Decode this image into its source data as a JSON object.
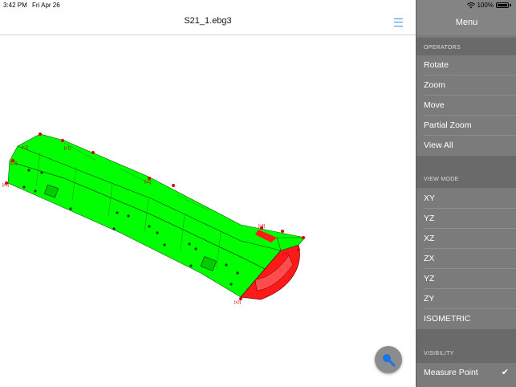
{
  "status_bar": {
    "time": "3:42 PM",
    "date": "Fri Apr 26",
    "battery": "100%"
  },
  "document": {
    "title": "S21_1.ebg3"
  },
  "sidebar": {
    "title": "Menu",
    "sections": [
      {
        "header": "OPERATORS",
        "items": [
          "Rotate",
          "Zoom",
          "Move",
          "Partial Zoom",
          "View All"
        ]
      },
      {
        "header": "VIEW MODE",
        "items": [
          "XY",
          "YZ",
          "XZ",
          "ZX",
          "YZ",
          "ZY",
          "ISOMETRIC"
        ]
      },
      {
        "header": "VISIBILITY",
        "items": [
          "Measure Point"
        ],
        "checked": [
          true
        ]
      }
    ]
  },
  "model_labels": [
    "[c1]",
    "[c1]",
    "[c2]",
    "[c3]",
    "[c3]",
    "[c4]",
    "[c4]",
    "[x2]"
  ],
  "colors": {
    "model_body": "#00ff00",
    "model_shadow": "#5fd35f",
    "curved_section": "#ff1a1a",
    "measure_points": "#e00000",
    "accent": "#3d8ee6",
    "fab_icon": "#1a73e8"
  },
  "icons": {
    "menu": "hamburger-icon",
    "fab": "search-icon",
    "check": "checkmark-icon"
  }
}
